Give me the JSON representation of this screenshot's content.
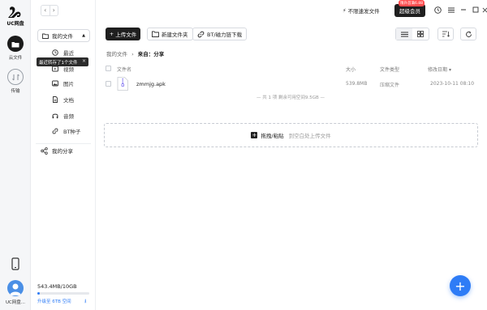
{
  "app": {
    "brand": "UC网盘",
    "accent_color": "#2e7cf6"
  },
  "rail": {
    "items": [
      {
        "label": "云文件",
        "icon": "cloud-folder-icon",
        "active": true
      },
      {
        "label": "传输",
        "icon": "transfer-icon",
        "active": false
      }
    ],
    "phone_icon": "phone-icon",
    "user_name": "UC网盘..."
  },
  "nav": {
    "back": "‹",
    "forward": "›"
  },
  "sidebar": {
    "my_files_label": "我的文件",
    "tooltip": "最近转存了1个文件",
    "items": [
      {
        "label": "最近",
        "icon": "clock-icon"
      },
      {
        "label": "视频",
        "icon": "video-icon"
      },
      {
        "label": "图片",
        "icon": "image-icon"
      },
      {
        "label": "文档",
        "icon": "document-icon"
      },
      {
        "label": "音频",
        "icon": "headphones-icon"
      },
      {
        "label": "BT种子",
        "icon": "bt-link-icon"
      }
    ],
    "my_share_label": "我的分享",
    "storage_text": "543.4MB/10GB",
    "storage_used_fraction": 0.053,
    "upgrade_text": "升级至 6TB 空间"
  },
  "topbar": {
    "speed_label": "不限速发文件",
    "vip_badge": "限升首满6.88",
    "vip_label": "超级会员"
  },
  "toolbar": {
    "upload_label": "上传文件",
    "new_folder_label": "新建文件夹",
    "bt_label": "BT/磁力链下载"
  },
  "breadcrumb": {
    "root": "我的文件",
    "separator": "›",
    "current": "来自：分享"
  },
  "table": {
    "headers": {
      "name": "文件名",
      "size": "大小",
      "type": "文件类型",
      "modified": "修改日期"
    },
    "sort_indicator": "▾",
    "rows": [
      {
        "name": "zmmjg.apk",
        "size": "539.8MB",
        "type": "压缩文件",
        "modified": "2023-10-11 08:10"
      }
    ],
    "summary": "共 1 项 剩余可用空间9.5GB"
  },
  "dropzone": {
    "label": "拖拽/粘贴",
    "hint": "到空白处上传文件"
  },
  "fab": {
    "label": "+"
  }
}
